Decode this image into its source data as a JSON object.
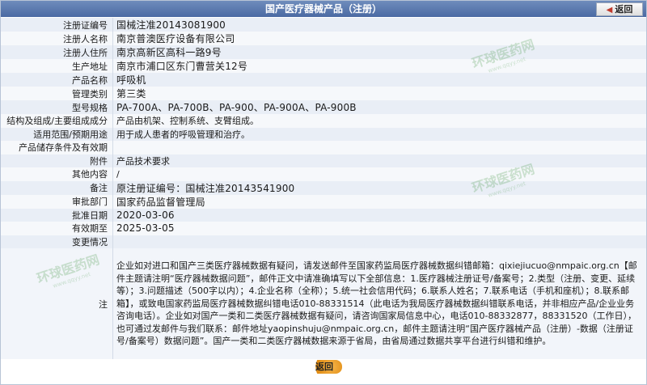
{
  "header": {
    "title": "国产医疗器械产品（注册）",
    "back_label": "返回"
  },
  "rows": [
    {
      "label": "注册证编号",
      "value": "国械注准20143081900"
    },
    {
      "label": "注册人名称",
      "value": "南京普澳医疗设备有限公司"
    },
    {
      "label": "注册人住所",
      "value": "南京高新区高科一路9号"
    },
    {
      "label": "生产地址",
      "value": "南京市浦口区东门曹营关12号"
    },
    {
      "label": "产品名称",
      "value": "呼吸机"
    },
    {
      "label": "管理类别",
      "value": "第三类"
    },
    {
      "label": "型号规格",
      "value": "PA-700A、PA-700B、PA-900、PA-900A、PA-900B"
    },
    {
      "label": "结构及组成/主要组成成分",
      "value": "产品由机架、控制系统、支臂组成。"
    },
    {
      "label": "适用范围/预期用途",
      "value": "用于成人患者的呼吸管理和治疗。"
    },
    {
      "label": "产品储存条件及有效期",
      "value": ""
    },
    {
      "label": "附件",
      "value": "产品技术要求"
    },
    {
      "label": "其他内容",
      "value": "/"
    },
    {
      "label": "备注",
      "value": "原注册证编号：国械注准20143541900"
    },
    {
      "label": "审批部门",
      "value": "国家药品监督管理局"
    },
    {
      "label": "批准日期",
      "value": "2020-03-06"
    },
    {
      "label": "有效期至",
      "value": "2025-03-05"
    },
    {
      "label": "变更情况",
      "value": ""
    }
  ],
  "note": {
    "label": "注",
    "text": "企业如对进口和国产三类医疗器械数据有疑问，请发送邮件至国家药监局医疗器械数据纠错邮箱：qixiejiucuo@nmpaic.org.cn【邮件主题请注明“医疗器械数据问题”，邮件正文中请准确填写以下全部信息：1.医疗器械注册证号/备案号；2.类型（注册、变更、延续等）；3.问题描述（500字以内）；4.企业名称（全称）；5.统一社会信用代码；6.联系人姓名；7.联系电话（手机和座机）；8.联系邮箱】，或致电国家药监局医疗器械数据纠错电话010-88331514（此电话为我局医疗器械数据纠错联系电话，并非相应产品/企业业务咨询电话）。企业如对国产一类和二类医疗器械数据有疑问，请咨询国家局信息中心，电话010-88332877，88331520（工作日），也可通过发邮件与我们联系：邮件地址yaopinshuju@nmpaic.org.cn，邮件主题请注明“国产医疗器械产品（注册）-数据（注册证号/备案号）数据问题”。国产一类和二类医疗器械数据来源于省局，由省局通过数据共享平台进行纠错和维护。"
  },
  "watermark": {
    "text": "环球医药网",
    "sub": "www.qqyy.net"
  },
  "footer": {
    "back_label": "返回"
  }
}
